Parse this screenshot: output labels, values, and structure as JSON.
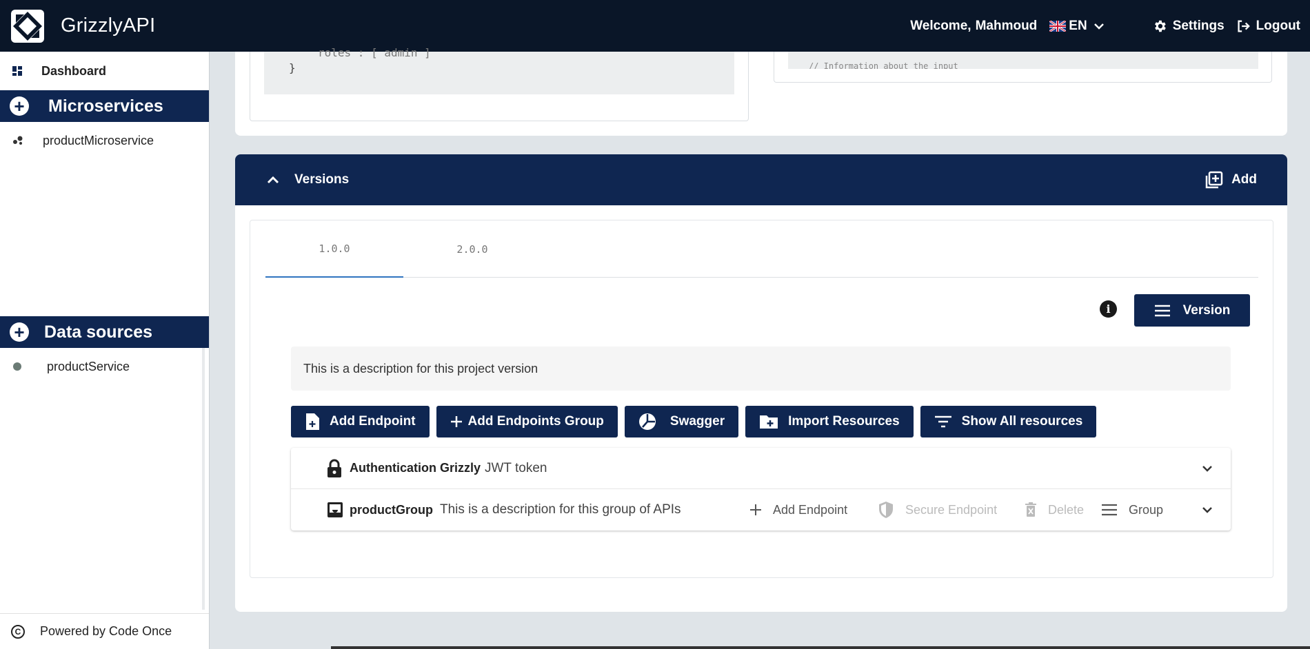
{
  "header": {
    "app_title": "GrizzlyAPI",
    "welcome": "Welcome,",
    "user": "Mahmoud",
    "lang": "EN",
    "settings": "Settings",
    "logout": "Logout"
  },
  "sidebar": {
    "dashboard": "Dashboard",
    "microservices_title": "Microservices",
    "microservices": [
      "productMicroservice"
    ],
    "datasources_title": "Data sources",
    "datasources": [
      "productService"
    ],
    "footer": "Powered by Code Once"
  },
  "code": {
    "line1": "roles : [ admin ]",
    "line2": "}",
    "right_line": "// Information about the input"
  },
  "versions": {
    "title": "Versions",
    "add": "Add",
    "tabs": [
      "1.0.0",
      "2.0.0"
    ],
    "version_btn": "Version",
    "description": "This is a description for this project version",
    "actions": {
      "add_endpoint": "Add Endpoint",
      "add_group": "Add Endpoints Group",
      "swagger": "Swagger",
      "import": "Import Resources",
      "show_all": "Show All resources"
    },
    "groups": {
      "auth_name": "Authentication Grizzly",
      "auth_desc": "JWT token",
      "group_name": "productGroup",
      "group_desc": "This is a description for this group of APIs",
      "add_endpoint": "Add Endpoint",
      "secure_endpoint": "Secure Endpoint",
      "delete": "Delete",
      "group": "Group"
    }
  },
  "colors": {
    "topbar": "#0a1628",
    "navy": "#0f2651",
    "tab_active": "#2f74c0"
  }
}
